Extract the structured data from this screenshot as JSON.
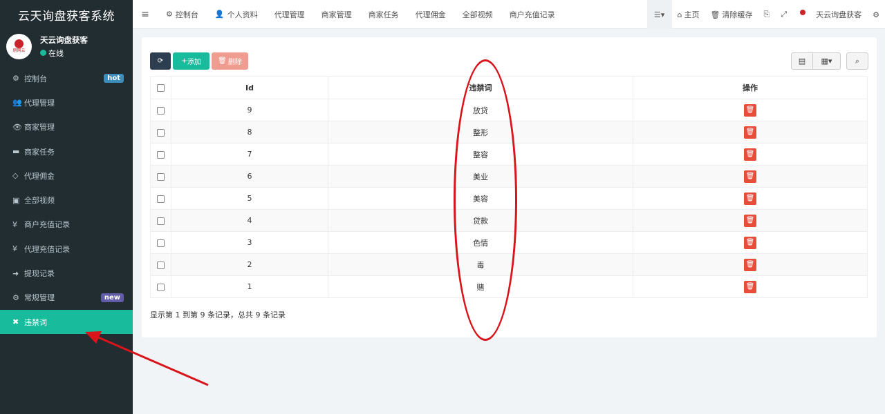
{
  "app": {
    "title": "云天询盘获客系统"
  },
  "user": {
    "name": "天云询盘获客",
    "status": "在线",
    "logo_text": "朋网云"
  },
  "sidebar": {
    "items": [
      {
        "label": "控制台",
        "icon": "⚙",
        "badge": "hot"
      },
      {
        "label": "代理管理",
        "icon": "👥",
        "badge": ""
      },
      {
        "label": "商家管理",
        "icon": "👁",
        "badge": ""
      },
      {
        "label": "商家任务",
        "icon": "▬",
        "badge": ""
      },
      {
        "label": "代理佣金",
        "icon": "◇",
        "badge": ""
      },
      {
        "label": "全部视频",
        "icon": "▣",
        "badge": ""
      },
      {
        "label": "商户充值记录",
        "icon": "¥",
        "badge": ""
      },
      {
        "label": "代理充值记录",
        "icon": "¥",
        "badge": ""
      },
      {
        "label": "提现记录",
        "icon": "➜",
        "badge": ""
      },
      {
        "label": "常规管理",
        "icon": "⚙",
        "badge": "new"
      },
      {
        "label": "违禁词",
        "icon": "✖",
        "badge": ""
      }
    ]
  },
  "topnav": {
    "tabs": [
      {
        "label": "控制台",
        "icon": "⚙"
      },
      {
        "label": "个人资料",
        "icon": "👤"
      },
      {
        "label": "代理管理",
        "icon": ""
      },
      {
        "label": "商家管理",
        "icon": ""
      },
      {
        "label": "商家任务",
        "icon": ""
      },
      {
        "label": "代理佣金",
        "icon": ""
      },
      {
        "label": "全部视频",
        "icon": ""
      },
      {
        "label": "商户充值记录",
        "icon": ""
      }
    ],
    "home": "主页",
    "clear_cache": "清除缓存",
    "account": "天云询盘获客"
  },
  "toolbar": {
    "add_label": "添加",
    "delete_label": "删除"
  },
  "table": {
    "headers": {
      "id": "Id",
      "word": "违禁词",
      "action": "操作"
    },
    "rows": [
      {
        "id": "9",
        "word": "放贷"
      },
      {
        "id": "8",
        "word": "整形"
      },
      {
        "id": "7",
        "word": "整容"
      },
      {
        "id": "6",
        "word": "美业"
      },
      {
        "id": "5",
        "word": "美容"
      },
      {
        "id": "4",
        "word": "贷款"
      },
      {
        "id": "3",
        "word": "色情"
      },
      {
        "id": "2",
        "word": "毒"
      },
      {
        "id": "1",
        "word": "赌"
      }
    ]
  },
  "pagination": {
    "text": "显示第 1 到第 9 条记录，总共 9 条记录"
  },
  "colors": {
    "sidebar": "#222d32",
    "accent": "#18bc9c",
    "danger": "#e74c3c",
    "annotation": "#d8151b"
  }
}
